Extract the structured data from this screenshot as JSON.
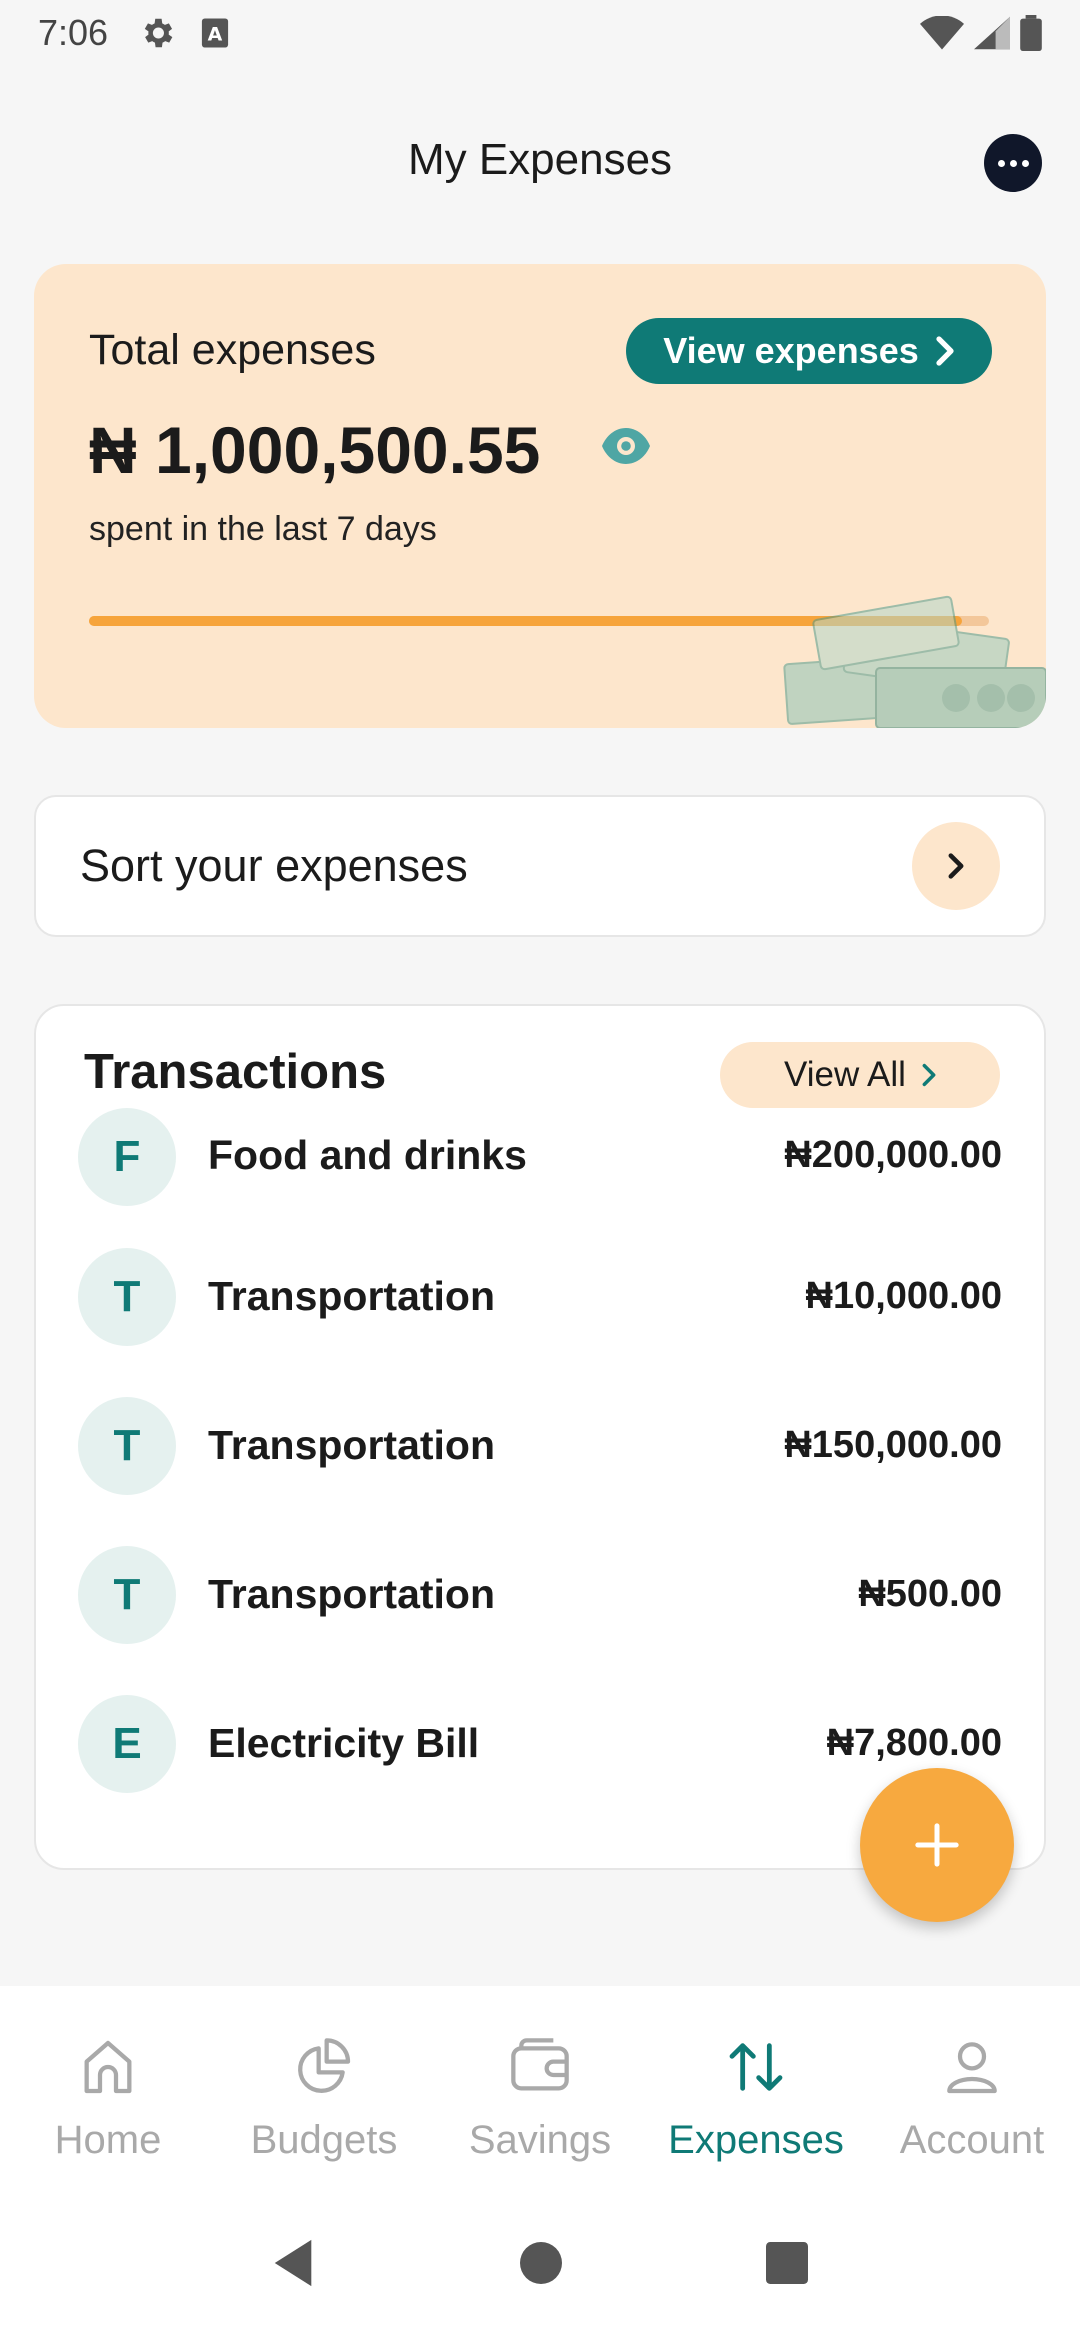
{
  "status_bar": {
    "time": "7:06",
    "icons": [
      "gear-icon",
      "keyboard-a-icon"
    ],
    "right_icons": [
      "wifi-icon",
      "signal-icon",
      "battery-icon"
    ]
  },
  "header": {
    "title": "My Expenses",
    "more_icon": "more-horizontal-icon"
  },
  "summary": {
    "label": "Total expenses",
    "view_button": "View expenses",
    "amount": "₦ 1,000,500.55",
    "period": "spent in the last 7 days",
    "progress_percent": 97,
    "accent": "#0f7a76",
    "progress_color": "#f6a43b",
    "card_bg": "#fde6cc"
  },
  "sort": {
    "label": "Sort your expenses"
  },
  "transactions": {
    "title": "Transactions",
    "view_all": "View All",
    "items": [
      {
        "initial": "F",
        "name": "Food and drinks",
        "amount": "₦200,000.00"
      },
      {
        "initial": "T",
        "name": "Transportation",
        "amount": "₦10,000.00"
      },
      {
        "initial": "T",
        "name": "Transportation",
        "amount": "₦150,000.00"
      },
      {
        "initial": "T",
        "name": "Transportation",
        "amount": "₦500.00"
      },
      {
        "initial": "E",
        "name": "Electricity Bill",
        "amount": "₦7,800.00"
      }
    ]
  },
  "fab": {
    "icon": "plus-icon",
    "color": "#f7a93f"
  },
  "bottom_nav": {
    "items": [
      {
        "label": "Home",
        "icon": "home-icon",
        "active": false
      },
      {
        "label": "Budgets",
        "icon": "pie-chart-icon",
        "active": false
      },
      {
        "label": "Savings",
        "icon": "wallet-icon",
        "active": false
      },
      {
        "label": "Expenses",
        "icon": "transfer-arrows-icon",
        "active": true
      },
      {
        "label": "Account",
        "icon": "user-icon",
        "active": false
      }
    ]
  },
  "system_nav": [
    "back-icon",
    "home-circle-icon",
    "recents-icon"
  ]
}
